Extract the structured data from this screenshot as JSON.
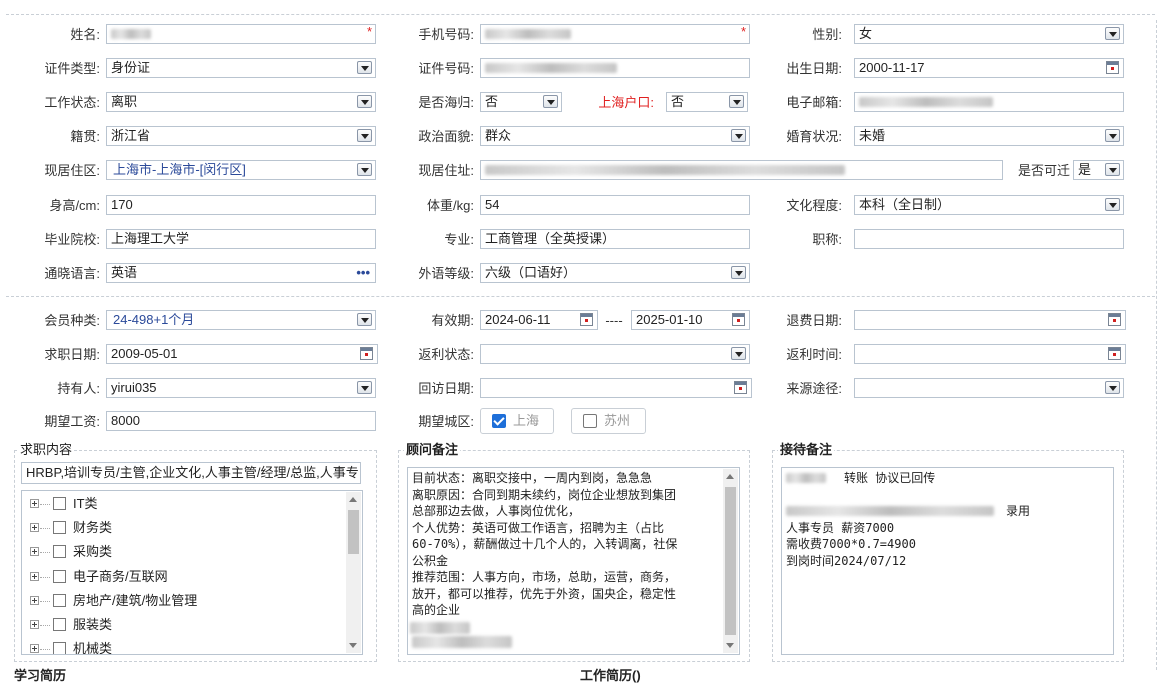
{
  "form": {
    "name_label": "姓名:",
    "phone_label": "手机号码:",
    "gender_label": "性别:",
    "gender_value": "女",
    "idtype_label": "证件类型:",
    "idtype_value": "身份证",
    "idno_label": "证件号码:",
    "birth_label": "出生日期:",
    "birth_value": "2000-11-17",
    "workstatus_label": "工作状态:",
    "workstatus_value": "离职",
    "returnee_label": "是否海归:",
    "returnee_value": "否",
    "shhukou_label": "上海户口:",
    "shhukou_value": "否",
    "email_label": "电子邮箱:",
    "native_label": "籍贯:",
    "native_value": "浙江省",
    "political_label": "政治面貌:",
    "political_value": "群众",
    "marital_label": "婚育状况:",
    "marital_value": "未婚",
    "residence_label": "现居住区:",
    "residence_value": "上海市-上海市-[闵行区]",
    "address_label": "现居住址:",
    "relocate_label": "是否可迁",
    "relocate_value": "是",
    "height_label": "身高/cm:",
    "height_value": "170",
    "weight_label": "体重/kg:",
    "weight_value": "54",
    "education_label": "文化程度:",
    "education_value": "本科（全日制）",
    "school_label": "毕业院校:",
    "school_value": "上海理工大学",
    "major_label": "专业:",
    "major_value": "工商管理（全英授课）",
    "title_label": "职称:",
    "title_value": "",
    "language_label": "通晓语言:",
    "language_value": "英语",
    "foreign_label": "外语等级:",
    "foreign_value": "六级（口语好）"
  },
  "membership": {
    "type_label": "会员种类:",
    "type_value": "24-498+1个月",
    "valid_label": "有效期:",
    "valid_from": "2024-06-11",
    "valid_sep": "----",
    "valid_to": "2025-01-10",
    "refund_label": "退费日期:",
    "jobdate_label": "求职日期:",
    "jobdate_value": "2009-05-01",
    "rebate_status_label": "返利状态:",
    "rebate_time_label": "返利时间:",
    "holder_label": "持有人:",
    "holder_value": "yirui035",
    "visit_label": "回访日期:",
    "source_label": "来源途径:",
    "salary_label": "期望工资:",
    "salary_value": "8000",
    "city_label": "期望城区:",
    "city_options": [
      {
        "label": "上海",
        "checked": true
      },
      {
        "label": "苏州",
        "checked": false
      }
    ]
  },
  "job_content": {
    "title": "求职内容",
    "summary": "HRBP,培训专员/主管,企业文化,人事主管/经理/总监,人事专",
    "tree": [
      "IT类",
      "财务类",
      "采购类",
      "电子商务/互联网",
      "房地产/建筑/物业管理",
      "服装类",
      "机械类"
    ]
  },
  "consultant": {
    "title": "顾问备注",
    "lines": [
      "目前状态：离职交接中，一周内到岗，急急急",
      "离职原因：合同到期未续约，岗位企业想放到集团",
      "总部那边去做，人事岗位优化，",
      "个人优势：英语可做工作语言，招聘为主（占比",
      "60-70%），薪酬做过十几个人的，入转调离，社保",
      "公积金",
      "推荐范围：人事方向，市场，总助，运营，商务，",
      "放开，都可以推荐，优先于外资，国央企，稳定性",
      "高的企业"
    ]
  },
  "reception": {
    "title": "接待备注",
    "line1_suffix": "转账   协议已回传",
    "line2_suffix": "录用",
    "line3": "人事专员   薪资7000",
    "line4": "需收费7000*0.7=4900",
    "line5": "到岗时间2024/07/12"
  },
  "bottom": {
    "study_title": "学习简历",
    "work_title": "工作简历()"
  },
  "colors": {
    "border": "#b9c4d0",
    "accent_blue": "#2b4a9a",
    "required_red": "#e02020",
    "checkbox_blue": "#1e6fd9"
  }
}
